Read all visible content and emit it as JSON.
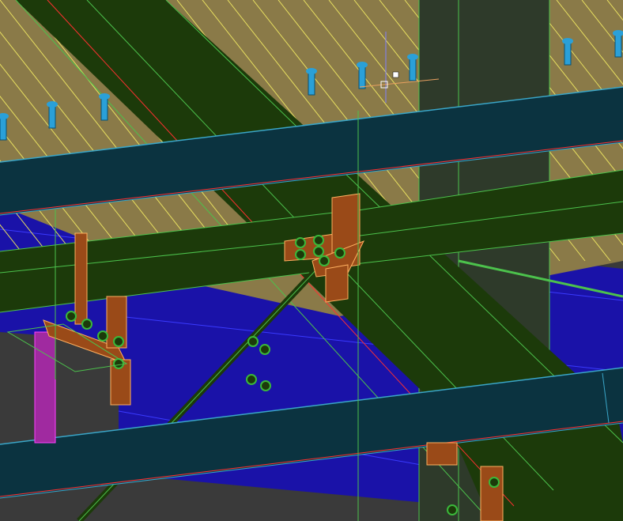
{
  "viewport": {
    "kind": "3d-model-view",
    "content": "steel-framing-connection"
  },
  "colors": {
    "background": "#3a3a3a",
    "deck": "#8a7a48",
    "deck_line": "#e8e060",
    "steel_beam_green": "#1c3a0a",
    "steel_edge_green": "#4cc24c",
    "steel_beam_teal": "#0b3340",
    "steel_edge_teal": "#3aa6c8",
    "girder_blue": "#1a12a8",
    "column_gray": "#2e3a2a",
    "plate_orange": "#9a4a18",
    "bolt_green": "#3ab83a",
    "shear_stud_blue": "#2aa0d8",
    "cursor_white": "#ffffff"
  },
  "components": {
    "floor_deck": "metal-deck",
    "shear_studs": "shear-stud",
    "diagonal_beam": "steel-w-beam",
    "cross_beam": "steel-w-beam",
    "top_girder": "hss-girder",
    "bottom_girder": "hss-girder",
    "lower_girder": "steel-girder",
    "column": "steel-column",
    "gusset_plates": "connection-plate",
    "bolts": "bolt",
    "brace_rod": "tension-rod"
  }
}
